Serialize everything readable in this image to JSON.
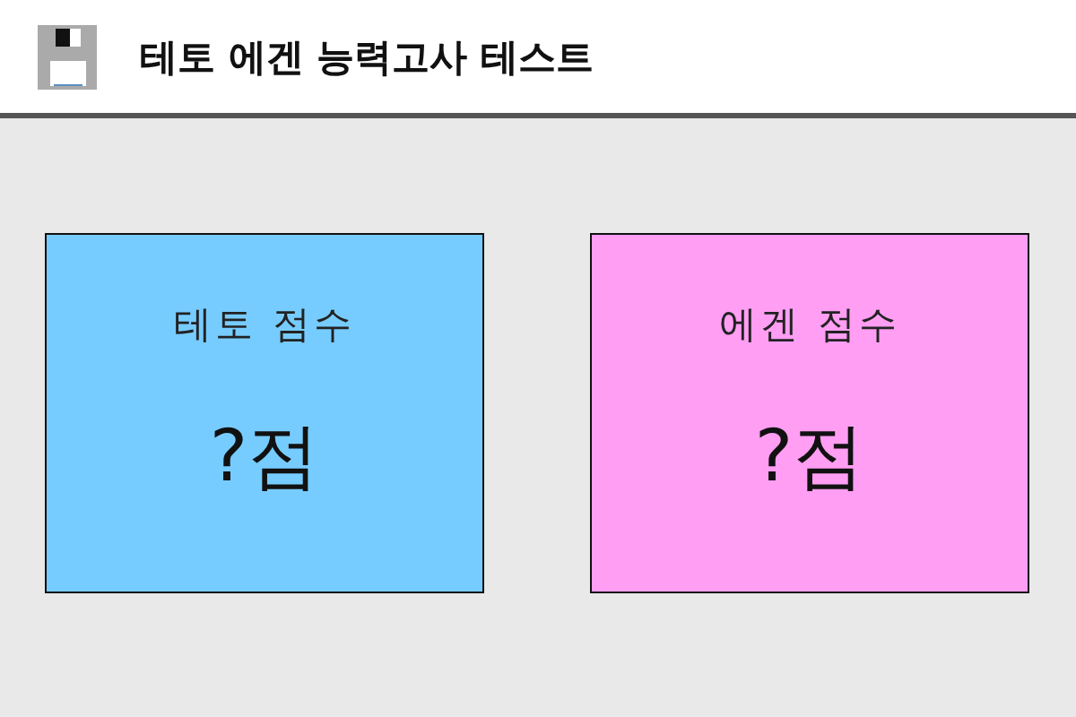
{
  "window": {
    "title": "테토 에겐 능력고사 테스트"
  },
  "cards": [
    {
      "label": "테토 점수",
      "score": "?점",
      "color": "#77ccff"
    },
    {
      "label": "에겐 점수",
      "score": "?점",
      "color": "#ff9ef3"
    }
  ]
}
